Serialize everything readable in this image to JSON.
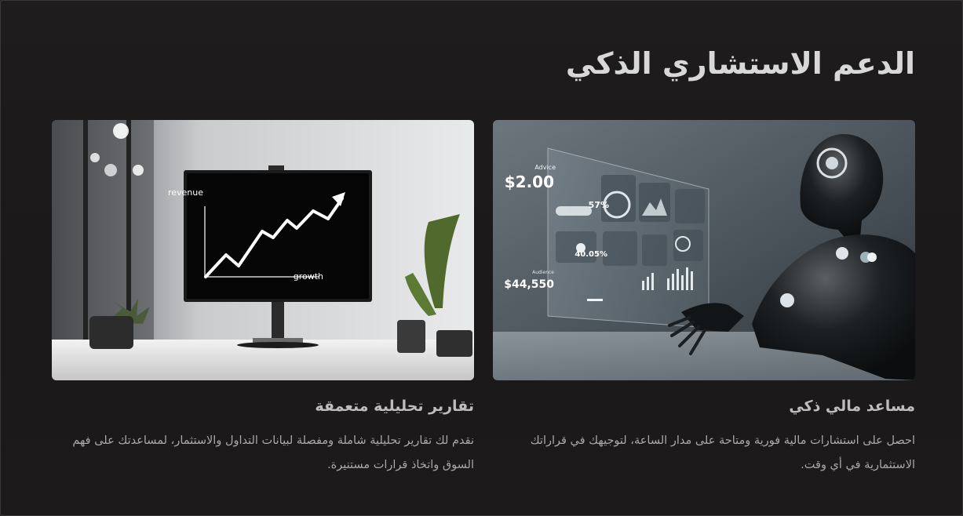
{
  "section": {
    "title": "الدعم الاستشاري الذكي"
  },
  "cards": [
    {
      "title": "مساعد مالي ذكي",
      "description": "احصل على استشارات مالية فورية ومتاحة على مدار الساعة، لتوجيهك في قراراتك الاستثمارية في أي وقت.",
      "image": {
        "icon": "robot-with-holographic-dashboard",
        "dashboard_texts": [
          "Advice",
          "$2.00",
          "57%",
          "40.05%",
          "$44,550",
          "Audience"
        ]
      }
    },
    {
      "title": "تقارير تحليلية متعمقة",
      "description": "نقدم لك تقارير تحليلية شاملة ومفصلة لبيانات التداول والاستثمار، لمساعدتك على فهم السوق واتخاذ قرارات مستنيرة.",
      "image": {
        "icon": "monitor-growth-chart",
        "chart_labels": {
          "top": "revenue",
          "bottom": "growth"
        }
      }
    }
  ],
  "colors": {
    "background": "#1c1a1a",
    "title": "#d8d8d8",
    "card_title": "#bdbdbd",
    "card_text": "#a9a9a9"
  }
}
